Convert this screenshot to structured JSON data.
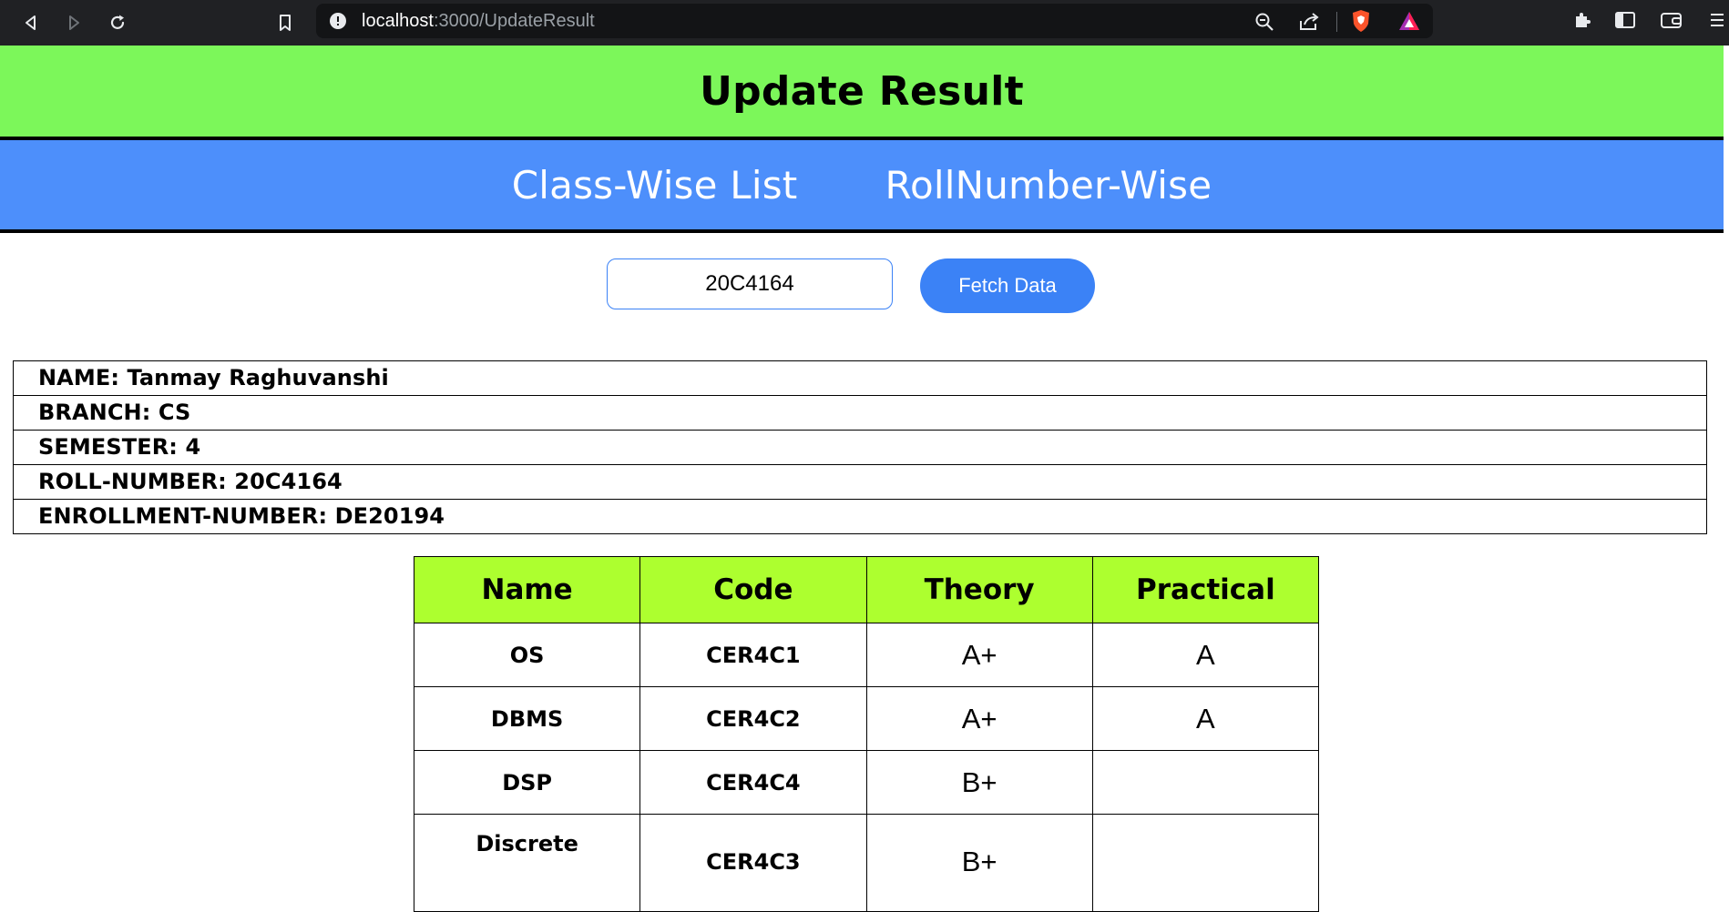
{
  "browser": {
    "url_host": "localhost",
    "url_path": ":3000/UpdateResult"
  },
  "page": {
    "title": "Update Result",
    "tabs": [
      {
        "label": "Class-Wise List"
      },
      {
        "label": "RollNumber-Wise"
      }
    ]
  },
  "search": {
    "value": "20C4164",
    "fetch_label": "Fetch Data"
  },
  "student": {
    "name": "NAME: Tanmay Raghuvanshi",
    "branch": "BRANCH: CS",
    "semester": "SEMESTER: 4",
    "roll_number": "ROLL-NUMBER: 20C4164",
    "enrollment_number": "ENROLLMENT-NUMBER: DE20194"
  },
  "results": {
    "headers": [
      "Name",
      "Code",
      "Theory",
      "Practical"
    ],
    "rows": [
      {
        "name": "OS",
        "code": "CER4C1",
        "theory": "A+",
        "practical": "A"
      },
      {
        "name": "DBMS",
        "code": "CER4C2",
        "theory": "A+",
        "practical": "A"
      },
      {
        "name": "DSP",
        "code": "CER4C4",
        "theory": "B+",
        "practical": ""
      },
      {
        "name": "Discrete",
        "code": "CER4C3",
        "theory": "B+",
        "practical": ""
      }
    ]
  },
  "colors": {
    "title_bar": "#7cf75a",
    "tabs_bar": "#4d8ffb",
    "table_header": "#adff2f",
    "button": "#3b82f6"
  }
}
